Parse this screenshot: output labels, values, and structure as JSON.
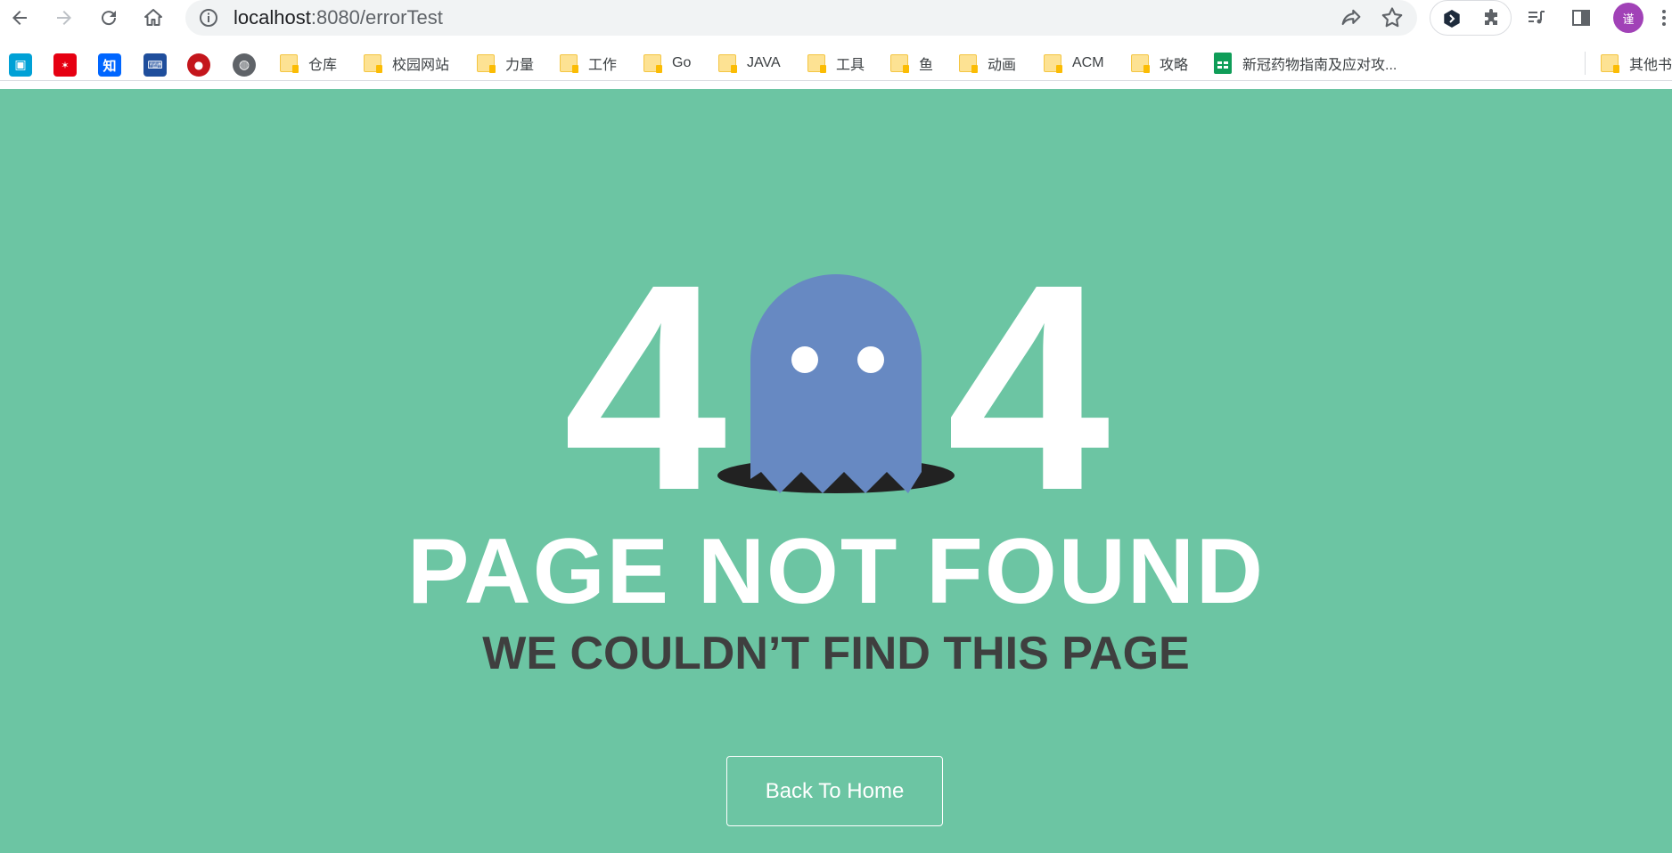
{
  "browser": {
    "url_host": "localhost",
    "url_path": ":8080/errorTest",
    "avatar_letter": "谨"
  },
  "bookmarks": {
    "folders": [
      "仓库",
      "校园网站",
      "力量",
      "工作",
      "Go",
      "JAVA",
      "工具",
      "鱼",
      "动画",
      "ACM",
      "攻略"
    ],
    "sheet_label": "新冠药物指南及应对攻...",
    "other_label": "其他书",
    "site_icons": [
      "bilibili-icon",
      "site-red-icon",
      "zhihu-icon",
      "devtools-icon",
      "school-seal-icon",
      "globe-icon"
    ]
  },
  "page": {
    "digit_left": "4",
    "digit_right": "4",
    "headline": "PAGE NOT FOUND",
    "subline": "WE COULDN’T FIND THIS PAGE",
    "button_label": "Back To Home",
    "colors": {
      "background": "#6cc5a3",
      "ghost": "#6789c2",
      "hole": "#222222",
      "subline": "#3f3f3f"
    }
  }
}
